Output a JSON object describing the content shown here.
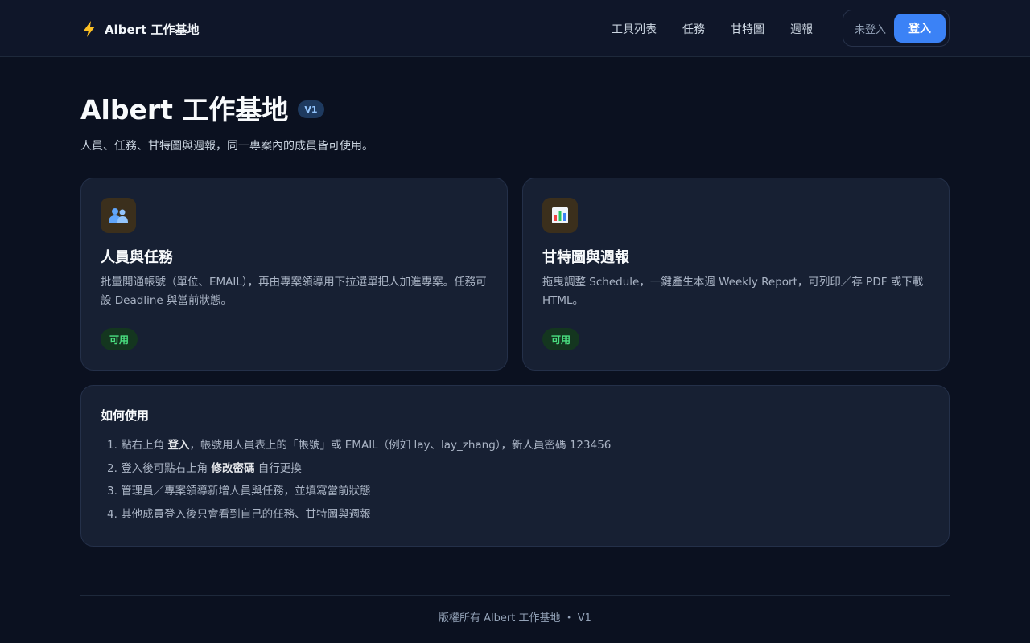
{
  "brand": {
    "icon": "lightning-bolt-icon",
    "name": "Albert 工作基地"
  },
  "nav": {
    "links": [
      "工具列表",
      "任務",
      "甘特圖",
      "週報"
    ]
  },
  "auth": {
    "status": "未登入",
    "login_label": "登入"
  },
  "header": {
    "title": "Albert 工作基地",
    "version": "V1",
    "subtitle": "人員、任務、甘特圖與週報，同一專案內的成員皆可使用。"
  },
  "cards": [
    {
      "icon": "people-icon",
      "title": "人員與任務",
      "description": "批量開通帳號（單位、EMAIL），再由專案領導用下拉選單把人加進專案。任務可設 Deadline 與當前狀態。",
      "status": "可用"
    },
    {
      "icon": "bar-chart-icon",
      "title": "甘特圖與週報",
      "description": "拖曳調整 Schedule，一鍵產生本週 Weekly Report，可列印／存 PDF 或下載 HTML。",
      "status": "可用"
    }
  ],
  "howto": {
    "title": "如何使用",
    "steps": [
      {
        "num": "1.",
        "before": "點右上角 ",
        "bold": "登入",
        "after": "，帳號用人員表上的「帳號」或 EMAIL（例如 lay、lay_zhang），新人員密碼 123456"
      },
      {
        "num": "2.",
        "before": "登入後可點右上角 ",
        "bold": "修改密碼",
        "after": " 自行更換"
      },
      {
        "num": "3.",
        "before": "管理員／專案領導新增人員與任務，並填寫當前狀態",
        "bold": "",
        "after": ""
      },
      {
        "num": "4.",
        "before": "其他成員登入後只會看到自己的任務、甘特圖與週報",
        "bold": "",
        "after": ""
      }
    ]
  },
  "footer": {
    "text": "版權所有 Albert 工作基地 ・ V1"
  },
  "colors": {
    "background": "#0b1120",
    "card": "#172033",
    "accent": "#3b82f6",
    "success": "#4ade80"
  }
}
